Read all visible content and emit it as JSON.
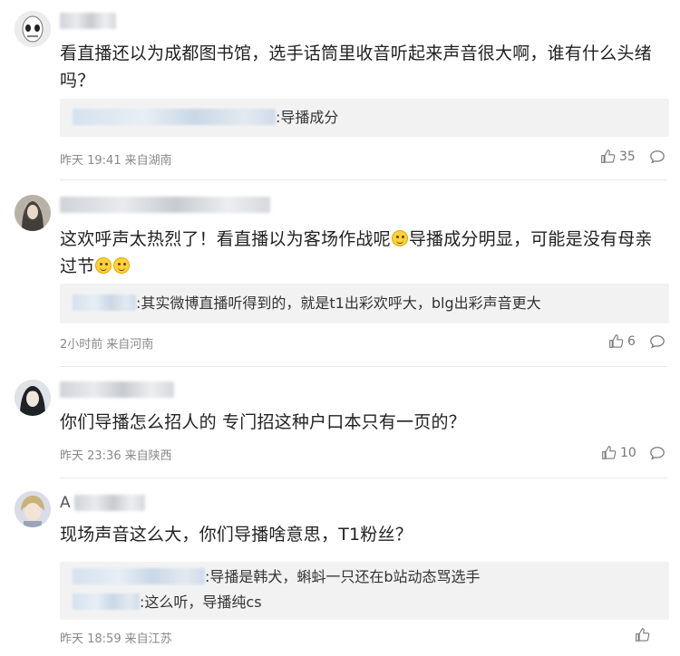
{
  "comments": [
    {
      "content": "看直播还以为成都图书馆，选手话筒里收音听起来声音很大啊，谁有什么头绪吗？",
      "replies": [
        {
          "text": ":导播成分"
        }
      ],
      "time": "昨天 19:41",
      "location": "来自湖南",
      "likes": "35"
    },
    {
      "content_a": "这欢呼声太热烈了！看直播以为客场作战呢",
      "content_b": "导播成分明显，可能是没有母亲过节",
      "replies": [
        {
          "text": ":其实微博直播听得到的，就是t1出彩欢呼大，blg出彩声音更大"
        }
      ],
      "time": "2小时前",
      "location": "来自河南",
      "likes": "6"
    },
    {
      "content": "你们导播怎么招人的 专门招这种户口本只有一页的？",
      "time": "昨天 23:36",
      "location": "来自陕西",
      "likes": "10"
    },
    {
      "username_initial": "A",
      "content": "现场声音这么大，你们导播啥意思，T1粉丝？",
      "replies": [
        {
          "text": ":导播是韩犬，蝌蚪一只还在b站动态骂选手"
        },
        {
          "text": ":这么听，导播纯cs"
        }
      ],
      "time": "昨天 18:59",
      "location": "来自江苏"
    }
  ],
  "icons": {
    "like": "thumbs-up-icon",
    "comment": "comment-bubble-icon"
  },
  "colors": {
    "reply_bg": "#f2f2f2",
    "meta": "#888888",
    "text": "#222222"
  }
}
